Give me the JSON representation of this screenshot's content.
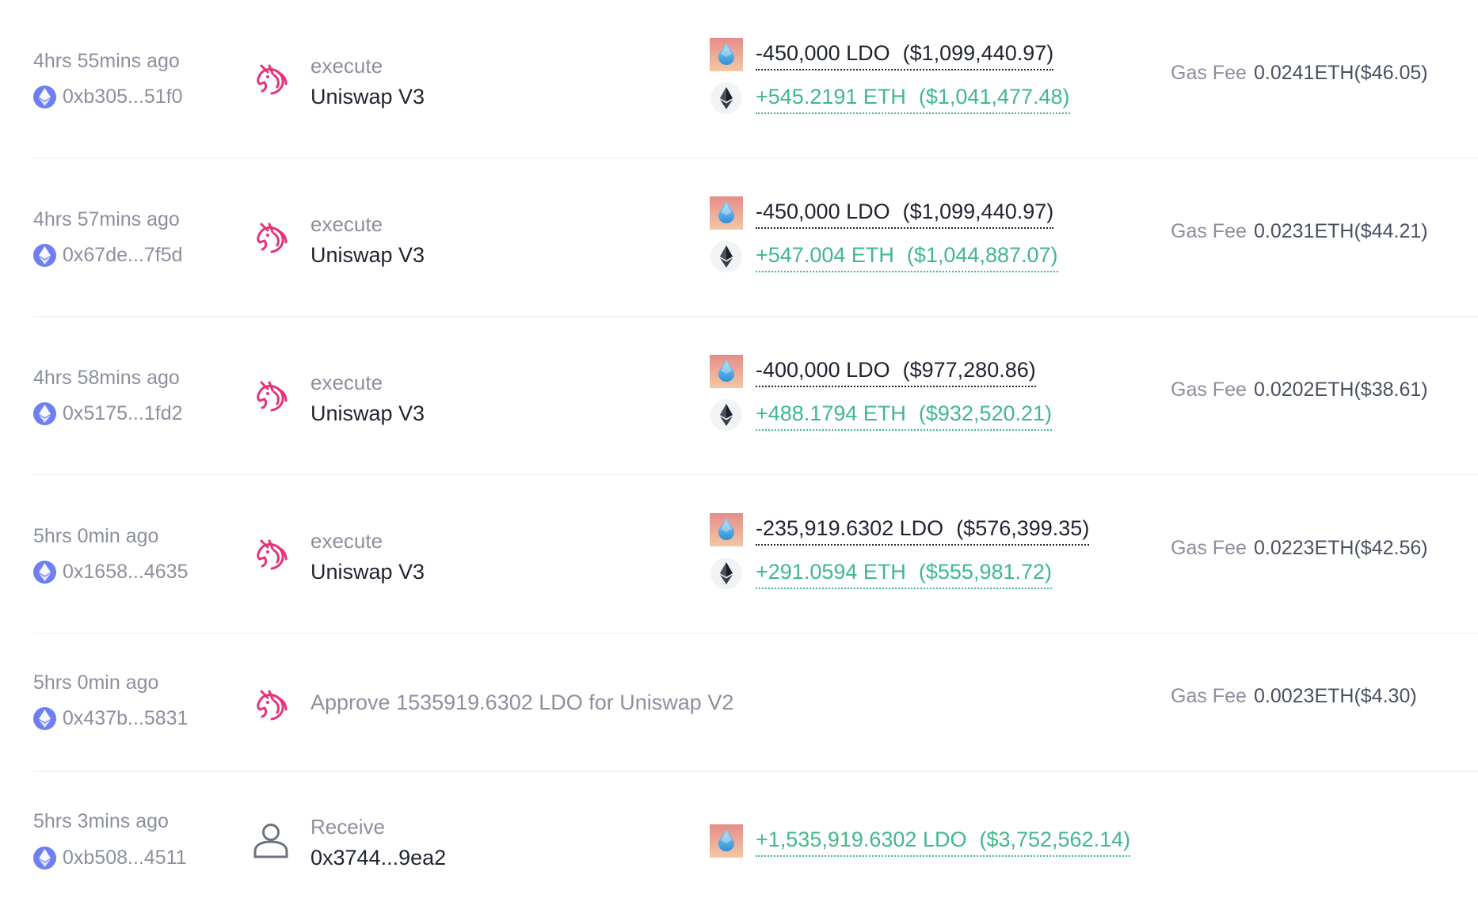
{
  "colors": {
    "uniswap_pink": "#e6317b",
    "positive_green": "#3fb98a",
    "muted_gray": "#8c909d",
    "eth_badge_blue": "#6e7ff1",
    "divider": "#ececf1"
  },
  "gas_label": "Gas Fee",
  "transactions": [
    {
      "time": "4hrs 55mins ago",
      "hash": "0xb305...51f0",
      "protocol_icon": "uniswap-unicorn-icon",
      "action": "execute",
      "target": "Uniswap V3",
      "transfers": [
        {
          "token_icon": "ldo-token-icon",
          "amount": "-450,000 LDO",
          "usd": "($1,099,440.97)",
          "direction": "out"
        },
        {
          "token_icon": "eth-token-icon",
          "amount": "+545.2191 ETH",
          "usd": "($1,041,477.48)",
          "direction": "in"
        }
      ],
      "gas_fee": "0.0241ETH($46.05)"
    },
    {
      "time": "4hrs 57mins ago",
      "hash": "0x67de...7f5d",
      "protocol_icon": "uniswap-unicorn-icon",
      "action": "execute",
      "target": "Uniswap V3",
      "transfers": [
        {
          "token_icon": "ldo-token-icon",
          "amount": "-450,000 LDO",
          "usd": "($1,099,440.97)",
          "direction": "out"
        },
        {
          "token_icon": "eth-token-icon",
          "amount": "+547.004 ETH",
          "usd": "($1,044,887.07)",
          "direction": "in"
        }
      ],
      "gas_fee": "0.0231ETH($44.21)"
    },
    {
      "time": "4hrs 58mins ago",
      "hash": "0x5175...1fd2",
      "protocol_icon": "uniswap-unicorn-icon",
      "action": "execute",
      "target": "Uniswap V3",
      "transfers": [
        {
          "token_icon": "ldo-token-icon",
          "amount": "-400,000 LDO",
          "usd": "($977,280.86)",
          "direction": "out"
        },
        {
          "token_icon": "eth-token-icon",
          "amount": "+488.1794 ETH",
          "usd": "($932,520.21)",
          "direction": "in"
        }
      ],
      "gas_fee": "0.0202ETH($38.61)"
    },
    {
      "time": "5hrs 0min ago",
      "hash": "0x1658...4635",
      "protocol_icon": "uniswap-unicorn-icon",
      "action": "execute",
      "target": "Uniswap V3",
      "transfers": [
        {
          "token_icon": "ldo-token-icon",
          "amount": "-235,919.6302 LDO",
          "usd": "($576,399.35)",
          "direction": "out"
        },
        {
          "token_icon": "eth-token-icon",
          "amount": "+291.0594 ETH",
          "usd": "($555,981.72)",
          "direction": "in"
        }
      ],
      "gas_fee": "0.0223ETH($42.56)"
    },
    {
      "time": "5hrs 0min ago",
      "hash": "0x437b...5831",
      "protocol_icon": "uniswap-unicorn-icon",
      "approve_text": "Approve 1535919.6302 LDO for Uniswap V2",
      "transfers": [],
      "gas_fee": "0.0023ETH($4.30)"
    },
    {
      "time": "5hrs 3mins ago",
      "hash": "0xb508...4511",
      "protocol_icon": "user-avatar-icon",
      "action": "Receive",
      "target": "0x3744...9ea2",
      "transfers": [
        {
          "token_icon": "ldo-token-icon",
          "amount": "+1,535,919.6302 LDO",
          "usd": "($3,752,562.14)",
          "direction": "in"
        }
      ]
    }
  ]
}
